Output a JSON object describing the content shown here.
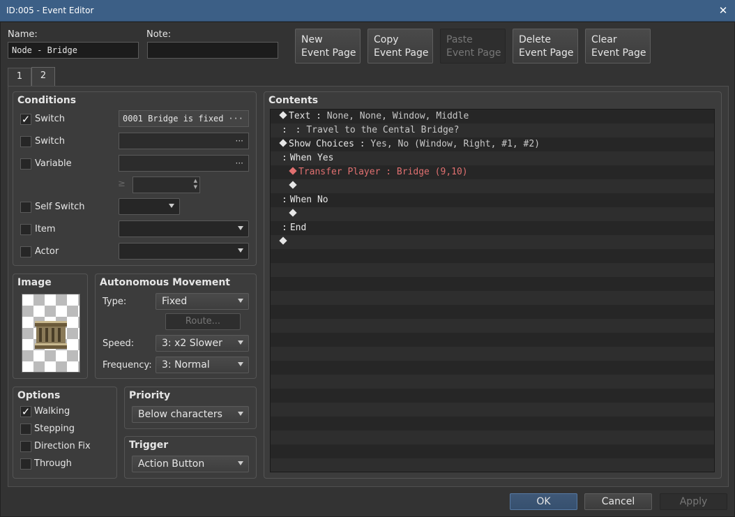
{
  "window": {
    "title": "ID:005 - Event Editor",
    "close_glyph": "✕"
  },
  "header": {
    "name_label": "Name:",
    "name_value": "Node - Bridge",
    "note_label": "Note:",
    "note_value": "",
    "buttons": [
      {
        "line1": "New",
        "line2": "Event Page",
        "enabled": true
      },
      {
        "line1": "Copy",
        "line2": "Event Page",
        "enabled": true
      },
      {
        "line1": "Paste",
        "line2": "Event Page",
        "enabled": false
      },
      {
        "line1": "Delete",
        "line2": "Event Page",
        "enabled": true
      },
      {
        "line1": "Clear",
        "line2": "Event Page",
        "enabled": true
      }
    ]
  },
  "tabs": [
    {
      "label": "1",
      "active": false
    },
    {
      "label": "2",
      "active": true
    }
  ],
  "conditions": {
    "title": "Conditions",
    "switch1": {
      "label": "Switch",
      "checked": true,
      "value": "0001 Bridge is fixed"
    },
    "switch2": {
      "label": "Switch",
      "checked": false,
      "value": ""
    },
    "variable": {
      "label": "Variable",
      "checked": false,
      "value": "",
      "ge": "≥",
      "amount": ""
    },
    "self_switch": {
      "label": "Self Switch",
      "checked": false,
      "value": ""
    },
    "item": {
      "label": "Item",
      "checked": false,
      "value": ""
    },
    "actor": {
      "label": "Actor",
      "checked": false,
      "value": ""
    }
  },
  "image": {
    "title": "Image",
    "icon": "bridge-tile-icon"
  },
  "movement": {
    "title": "Autonomous Movement",
    "type_label": "Type:",
    "type_value": "Fixed",
    "route_label": "Route...",
    "speed_label": "Speed:",
    "speed_value": "3: x2 Slower",
    "frequency_label": "Frequency:",
    "frequency_value": "3: Normal"
  },
  "options": {
    "title": "Options",
    "items": [
      {
        "label": "Walking",
        "checked": true
      },
      {
        "label": "Stepping",
        "checked": false
      },
      {
        "label": "Direction Fix",
        "checked": false
      },
      {
        "label": "Through",
        "checked": false
      }
    ]
  },
  "priority": {
    "title": "Priority",
    "value": "Below characters"
  },
  "trigger": {
    "title": "Trigger",
    "value": "Action Button"
  },
  "contents": {
    "title": "Contents",
    "lines": [
      {
        "indent": 0,
        "marker": "diamond",
        "cmd": "Text",
        "sep": " : ",
        "args": "None, None, Window, Middle",
        "color": "normal"
      },
      {
        "indent": 0,
        "marker": "colon",
        "cmd": "",
        "sep": "    : ",
        "args": "Travel to the Cental Bridge?",
        "color": "normal"
      },
      {
        "indent": 0,
        "marker": "diamond",
        "cmd": "Show Choices",
        "sep": " : ",
        "args": "Yes, No (Window, Right, #1, #2)",
        "color": "normal"
      },
      {
        "indent": 0,
        "marker": "colon",
        "cmd": "When Yes",
        "sep": "",
        "args": "",
        "color": "normal"
      },
      {
        "indent": 1,
        "marker": "diamond",
        "cmd": "Transfer Player",
        "sep": " : ",
        "args": "Bridge (9,10)",
        "color": "red"
      },
      {
        "indent": 1,
        "marker": "diamond",
        "cmd": "",
        "sep": "",
        "args": "",
        "color": "normal"
      },
      {
        "indent": 0,
        "marker": "colon",
        "cmd": "When No",
        "sep": "",
        "args": "",
        "color": "normal"
      },
      {
        "indent": 1,
        "marker": "diamond",
        "cmd": "",
        "sep": "",
        "args": "",
        "color": "normal"
      },
      {
        "indent": 0,
        "marker": "colon",
        "cmd": "End",
        "sep": "",
        "args": "",
        "color": "normal"
      },
      {
        "indent": 0,
        "marker": "diamond",
        "cmd": "",
        "sep": "",
        "args": "",
        "color": "normal"
      }
    ]
  },
  "footer": {
    "ok": "OK",
    "cancel": "Cancel",
    "apply": "Apply"
  }
}
